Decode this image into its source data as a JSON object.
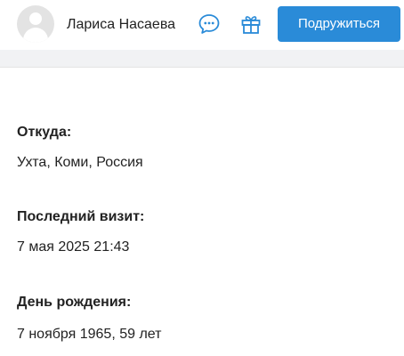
{
  "header": {
    "user_name": "Лариса Насаева",
    "add_friend_label": "Подружиться",
    "icons": [
      "avatar-placeholder",
      "chat-icon",
      "gift-icon"
    ],
    "accent_color": "#2a8bd8"
  },
  "profile": {
    "from": {
      "label": "Откуда:",
      "value": "Ухта, Коми, Россия"
    },
    "last_visit": {
      "label": "Последний визит:",
      "value": "7 мая 2025 21:43"
    },
    "birthday": {
      "label": "День рождения:",
      "value": "7 ноября 1965, 59 лет"
    }
  }
}
